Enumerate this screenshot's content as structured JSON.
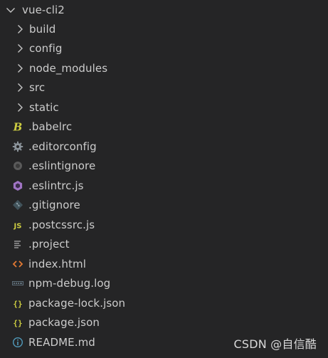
{
  "explorer": {
    "root": {
      "label": "vue-cli2",
      "icon": "chevron-down-icon"
    },
    "folders": [
      {
        "label": "build",
        "icon": "chevron-right-icon"
      },
      {
        "label": "config",
        "icon": "chevron-right-icon"
      },
      {
        "label": "node_modules",
        "icon": "chevron-right-icon"
      },
      {
        "label": "src",
        "icon": "chevron-right-icon"
      },
      {
        "label": "static",
        "icon": "chevron-right-icon"
      }
    ],
    "files": [
      {
        "label": ".babelrc",
        "icon": "babel-icon",
        "color": "#cbcb41"
      },
      {
        "label": ".editorconfig",
        "icon": "gear-icon",
        "color": "#8a9299"
      },
      {
        "label": ".eslintignore",
        "icon": "eslint-ignore-icon",
        "color": "#6d6d6d"
      },
      {
        "label": ".eslintrc.js",
        "icon": "eslint-icon",
        "color": "#a074c4"
      },
      {
        "label": ".gitignore",
        "icon": "git-icon",
        "color": "#41535b"
      },
      {
        "label": ".postcssrc.js",
        "icon": "js-icon",
        "color": "#cbcb41"
      },
      {
        "label": ".project",
        "icon": "text-file-icon",
        "color": "#a0a0a0"
      },
      {
        "label": "index.html",
        "icon": "html-icon",
        "color": "#e37933"
      },
      {
        "label": "npm-debug.log",
        "icon": "log-icon",
        "color": "#5f6f7a"
      },
      {
        "label": "package-lock.json",
        "icon": "json-icon",
        "color": "#cbcb41"
      },
      {
        "label": "package.json",
        "icon": "json-icon",
        "color": "#cbcb41"
      },
      {
        "label": "README.md",
        "icon": "info-icon",
        "color": "#519aba"
      }
    ]
  },
  "watermark": "CSDN @自信酷"
}
